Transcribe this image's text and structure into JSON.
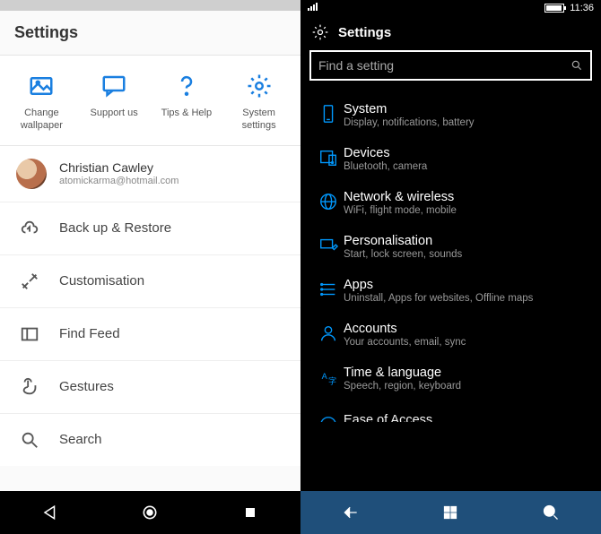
{
  "left": {
    "title": "Settings",
    "quick": [
      {
        "label": "Change wallpaper",
        "icon": "picture-icon"
      },
      {
        "label": "Support us",
        "icon": "chat-icon"
      },
      {
        "label": "Tips & Help",
        "icon": "question-icon"
      },
      {
        "label": "System settings",
        "icon": "gear-icon"
      }
    ],
    "account": {
      "name": "Christian Cawley",
      "email": "atomickarma@hotmail.com"
    },
    "menu": [
      {
        "label": "Back up & Restore",
        "icon": "cloud-upload-icon"
      },
      {
        "label": "Customisation",
        "icon": "brush-icon"
      },
      {
        "label": "Find Feed",
        "icon": "panel-icon"
      },
      {
        "label": "Gestures",
        "icon": "gesture-icon"
      },
      {
        "label": "Search",
        "icon": "search-icon"
      }
    ]
  },
  "right": {
    "time": "11:36",
    "title": "Settings",
    "search_placeholder": "Find a setting",
    "categories": [
      {
        "name": "System",
        "desc": "Display, notifications, battery",
        "icon": "phone-icon"
      },
      {
        "name": "Devices",
        "desc": "Bluetooth, camera",
        "icon": "devices-icon"
      },
      {
        "name": "Network & wireless",
        "desc": "WiFi, flight mode, mobile",
        "icon": "globe-icon"
      },
      {
        "name": "Personalisation",
        "desc": "Start, lock screen, sounds",
        "icon": "personalise-icon"
      },
      {
        "name": "Apps",
        "desc": "Uninstall, Apps for websites, Offline maps",
        "icon": "apps-icon"
      },
      {
        "name": "Accounts",
        "desc": "Your accounts, email, sync",
        "icon": "person-icon"
      },
      {
        "name": "Time & language",
        "desc": "Speech, region, keyboard",
        "icon": "language-icon"
      },
      {
        "name": "Ease of Access",
        "desc": "",
        "icon": "ease-icon"
      }
    ]
  }
}
